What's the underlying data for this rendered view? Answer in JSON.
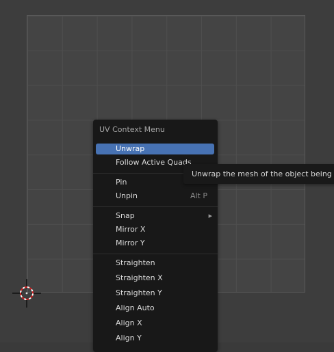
{
  "menu": {
    "title": "UV Context Menu",
    "groups": [
      {
        "items": [
          {
            "label": "Unwrap",
            "shortcut": "",
            "active": true
          },
          {
            "label": "Follow Active Quads",
            "shortcut": ""
          }
        ]
      },
      {
        "items": [
          {
            "label": "Pin",
            "shortcut": ""
          },
          {
            "label": "Unpin",
            "shortcut": "Alt P"
          }
        ]
      },
      {
        "items": [
          {
            "label": "Snap",
            "submenu": true
          },
          {
            "label": "Mirror X",
            "shortcut": ""
          },
          {
            "label": "Mirror Y",
            "shortcut": ""
          }
        ]
      },
      {
        "items": [
          {
            "label": "Straighten",
            "shortcut": ""
          },
          {
            "label": "Straighten X",
            "shortcut": ""
          },
          {
            "label": "Straighten Y",
            "shortcut": ""
          },
          {
            "label": "Align Auto",
            "shortcut": ""
          },
          {
            "label": "Align X",
            "shortcut": ""
          },
          {
            "label": "Align Y",
            "shortcut": ""
          }
        ]
      }
    ]
  },
  "tooltip": {
    "text": "Unwrap the mesh of the object being edit"
  },
  "colors": {
    "highlight": "#4772b3",
    "menu_background": "#181818",
    "editor_background": "#3d3d3d",
    "grid_background": "#444444"
  },
  "icons": {
    "cursor": "3d-cursor-icon",
    "submenu": "submenu-arrow-icon"
  }
}
